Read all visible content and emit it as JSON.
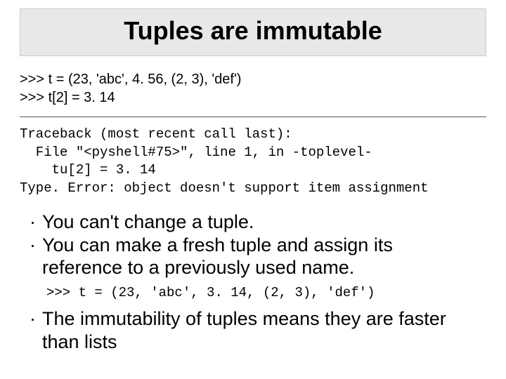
{
  "title": "Tuples are immutable",
  "input_code": {
    "line1": ">>> t = (23, 'abc', 4. 56, (2, 3), 'def')",
    "line2": ">>> t[2] = 3. 14"
  },
  "traceback": "Traceback (most recent call last):\n  File \"<pyshell#75>\", line 1, in -toplevel-\n    tu[2] = 3. 14\nType. Error: object doesn't support item assignment",
  "bullets": {
    "b1": "You can't change a tuple.",
    "b2": "You can make a fresh tuple and assign its reference to a previously used name.",
    "b3": "The immutability of tuples means they are faster than lists"
  },
  "example_code": ">>> t = (23, 'abc', 3. 14, (2, 3), 'def')"
}
